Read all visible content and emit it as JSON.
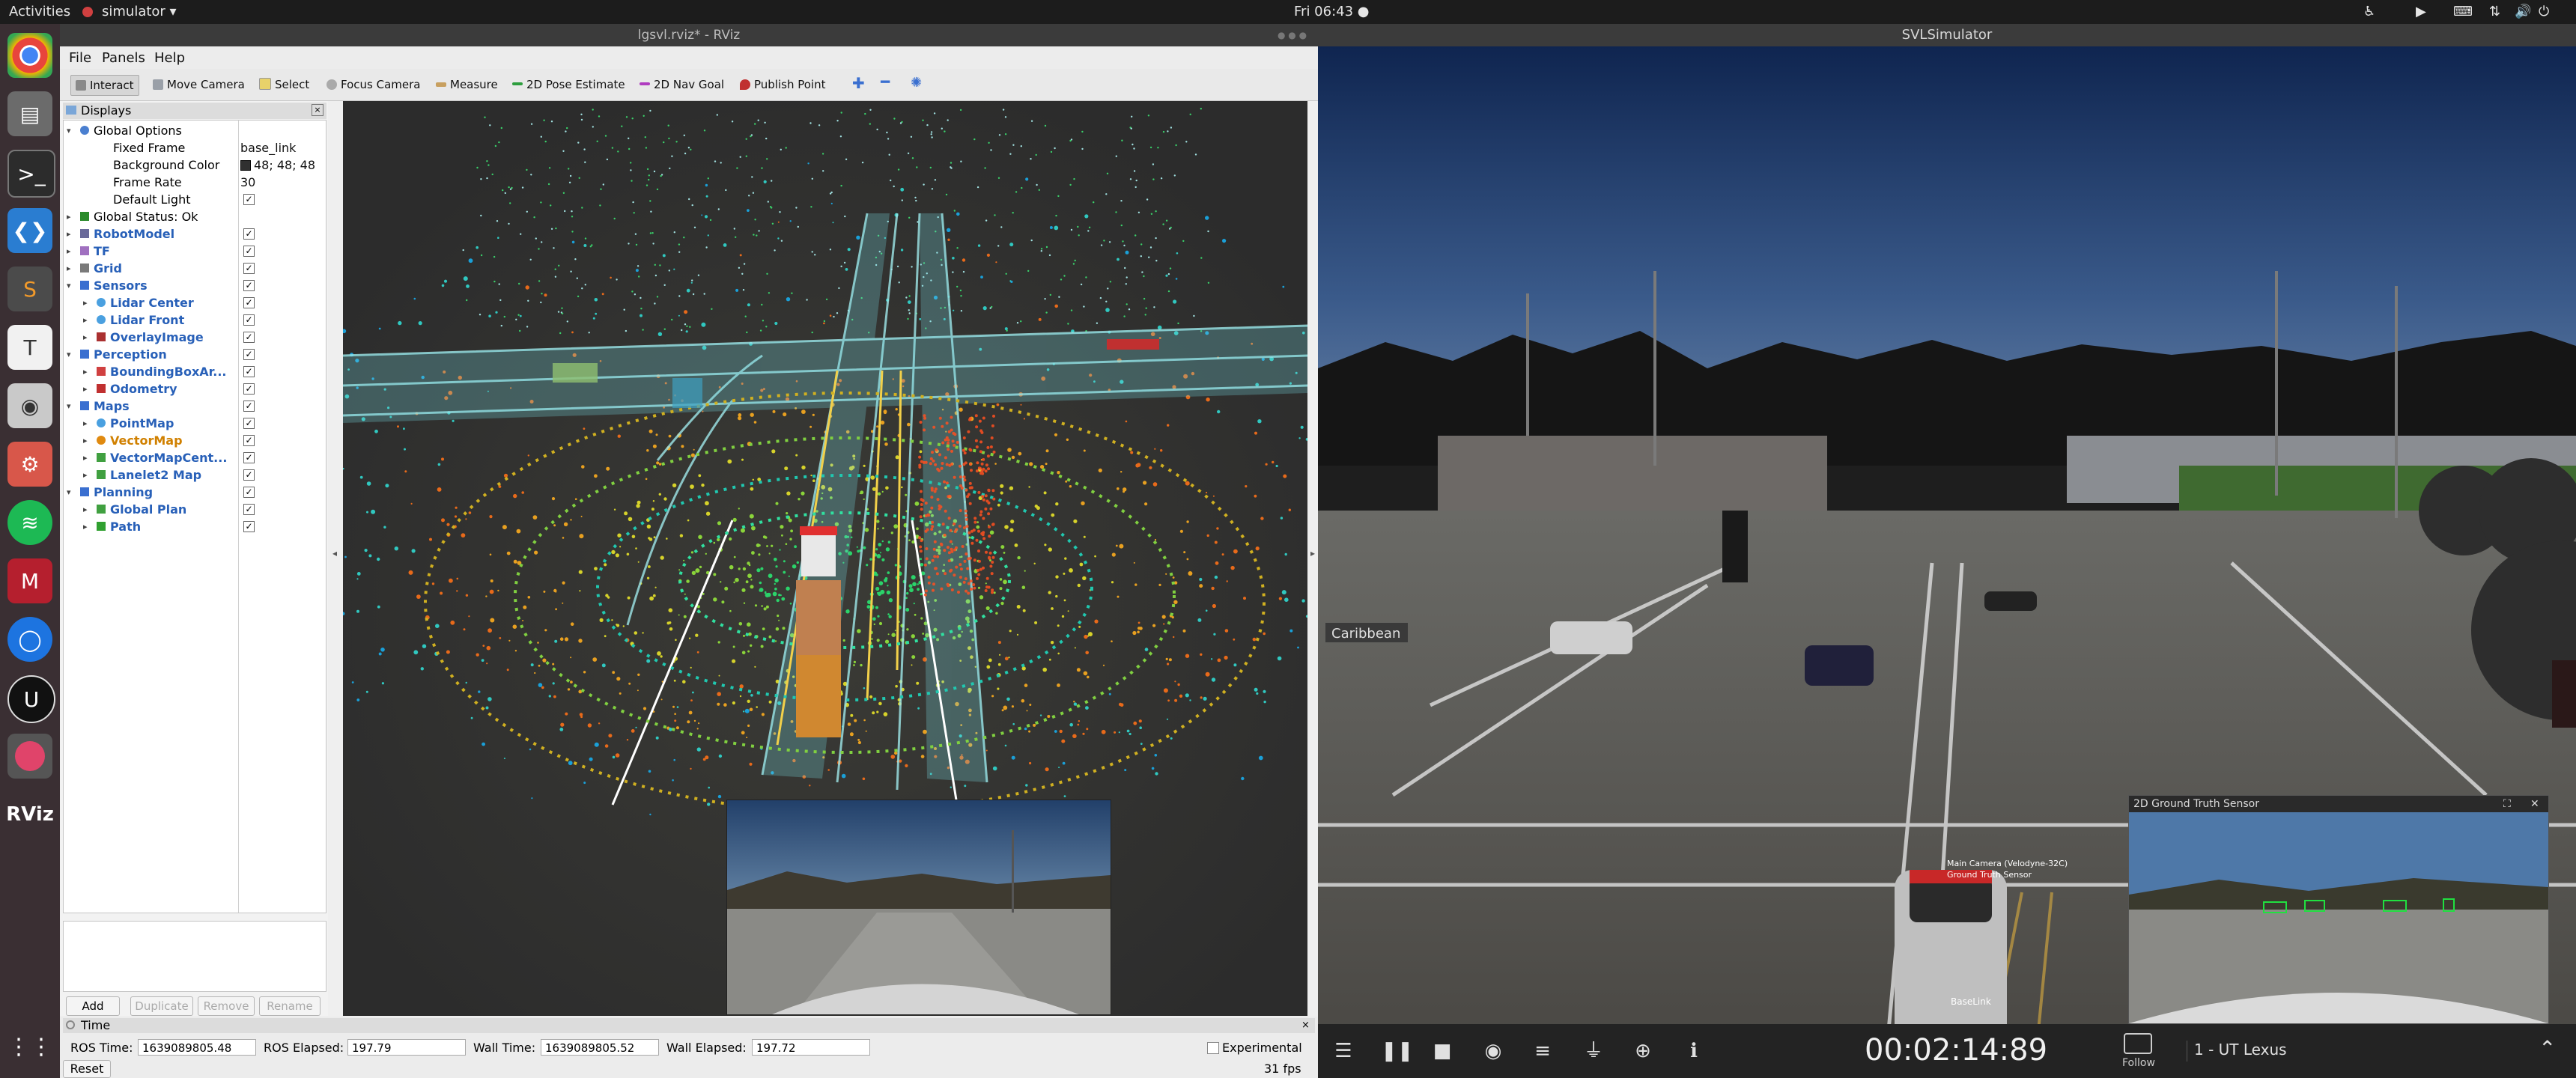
{
  "topbar": {
    "activities": "Activities",
    "app_menu": "simulator ▾",
    "clock": "Fri 06:43 ●"
  },
  "dock": {
    "items": [
      "chrome",
      "files",
      "terminal",
      "vscode",
      "sublime",
      "typora",
      "screenshot",
      "settings",
      "spotify",
      "mendeley",
      "sync",
      "unreal",
      "svl",
      "rviz"
    ],
    "rviz_label": "RViz"
  },
  "rviz": {
    "title": "lgsvl.rviz* - RViz",
    "menu": [
      "File",
      "Panels",
      "Help"
    ],
    "toolbar": [
      "Interact",
      "Move Camera",
      "Select",
      "Focus Camera",
      "Measure",
      "2D Pose Estimate",
      "2D Nav Goal",
      "Publish Point"
    ],
    "toolbar_colors": {
      "select": "#e8d26a",
      "pose": "#2e9e3e",
      "nav": "#b03cc0",
      "publish": "#c03030",
      "plus": "#3a6fd0"
    },
    "displays": {
      "title": "Displays",
      "rows": [
        {
          "label": "Global Options",
          "indent": 0,
          "arrow": "▾",
          "icon": "globe",
          "style": "normal"
        },
        {
          "label": "Fixed Frame",
          "indent": 2,
          "value": "base_link",
          "style": "normal"
        },
        {
          "label": "Background Color",
          "indent": 2,
          "value": "48; 48; 48",
          "swatch": "#303030",
          "style": "normal"
        },
        {
          "label": "Frame Rate",
          "indent": 2,
          "value": "30",
          "style": "normal"
        },
        {
          "label": "Default Light",
          "indent": 2,
          "check": "✓",
          "style": "normal"
        },
        {
          "label": "Global Status: Ok",
          "indent": 0,
          "arrow": "▸",
          "icon": "ok",
          "style": "normal"
        },
        {
          "label": "RobotModel",
          "indent": 0,
          "arrow": "▸",
          "icon": "robot",
          "check": "✓",
          "style": "blue"
        },
        {
          "label": "TF",
          "indent": 0,
          "arrow": "▸",
          "icon": "tf",
          "check": "✓",
          "style": "blue"
        },
        {
          "label": "Grid",
          "indent": 0,
          "arrow": "▸",
          "icon": "grid",
          "check": "✓",
          "style": "blue"
        },
        {
          "label": "Sensors",
          "indent": 0,
          "arrow": "▾",
          "icon": "folder",
          "check": "✓",
          "style": "blue"
        },
        {
          "label": "Lidar Center",
          "indent": 1,
          "arrow": "▸",
          "icon": "points",
          "check": "✓",
          "style": "blue"
        },
        {
          "label": "Lidar Front",
          "indent": 1,
          "arrow": "▸",
          "icon": "points",
          "check": "✓",
          "style": "blue"
        },
        {
          "label": "OverlayImage",
          "indent": 1,
          "arrow": "▸",
          "icon": "image",
          "check": "✓",
          "style": "blue"
        },
        {
          "label": "Perception",
          "indent": 0,
          "arrow": "▾",
          "icon": "folder",
          "check": "✓",
          "style": "blue"
        },
        {
          "label": "BoundingBoxAr...",
          "indent": 1,
          "arrow": "▸",
          "icon": "bbox",
          "check": "✓",
          "style": "blue"
        },
        {
          "label": "Odometry",
          "indent": 1,
          "arrow": "▸",
          "icon": "odom",
          "check": "✓",
          "style": "blue"
        },
        {
          "label": "Maps",
          "indent": 0,
          "arrow": "▾",
          "icon": "folder",
          "check": "✓",
          "style": "blue"
        },
        {
          "label": "PointMap",
          "indent": 1,
          "arrow": "▸",
          "icon": "points",
          "check": "✓",
          "style": "blue"
        },
        {
          "label": "VectorMap",
          "indent": 1,
          "arrow": "▸",
          "icon": "warn",
          "check": "✓",
          "style": "orange"
        },
        {
          "label": "VectorMapCent...",
          "indent": 1,
          "arrow": "▸",
          "icon": "marker",
          "check": "✓",
          "style": "blue"
        },
        {
          "label": "Lanelet2 Map",
          "indent": 1,
          "arrow": "▸",
          "icon": "marker",
          "check": "✓",
          "style": "blue"
        },
        {
          "label": "Planning",
          "indent": 0,
          "arrow": "▾",
          "icon": "folder",
          "check": "✓",
          "style": "blue"
        },
        {
          "label": "Global Plan",
          "indent": 1,
          "arrow": "▸",
          "icon": "marker",
          "check": "✓",
          "style": "blue"
        },
        {
          "label": "Path",
          "indent": 1,
          "arrow": "▸",
          "icon": "path",
          "check": "✓",
          "style": "blue"
        }
      ],
      "buttons": [
        "Add",
        "Duplicate",
        "Remove",
        "Rename"
      ]
    },
    "time": {
      "title": "Time",
      "ros_time_label": "ROS Time:",
      "ros_time": "1639089805.48",
      "ros_elapsed_label": "ROS Elapsed:",
      "ros_elapsed": "197.79",
      "wall_time_label": "Wall Time:",
      "wall_time": "1639089805.52",
      "wall_elapsed_label": "Wall Elapsed:",
      "wall_elapsed": "197.72",
      "experimental": "Experimental",
      "reset": "Reset",
      "fps": "31 fps"
    }
  },
  "svl": {
    "title": "SVLSimulator",
    "sign": "Caribbean",
    "gt_title": "2D Ground Truth Sensor",
    "ego_labels": [
      "Main Camera (Velodyne-32C)",
      "Ground Truth Sensor",
      "BaseLink"
    ],
    "clock": "00:02:14:89",
    "follow": "Follow",
    "vehicle": "1 - UT Lexus",
    "controls": [
      "menu-icon",
      "pause-icon",
      "stop-icon",
      "eye-icon",
      "sliders-icon",
      "plug-icon",
      "gamepad-icon",
      "info-icon"
    ]
  }
}
